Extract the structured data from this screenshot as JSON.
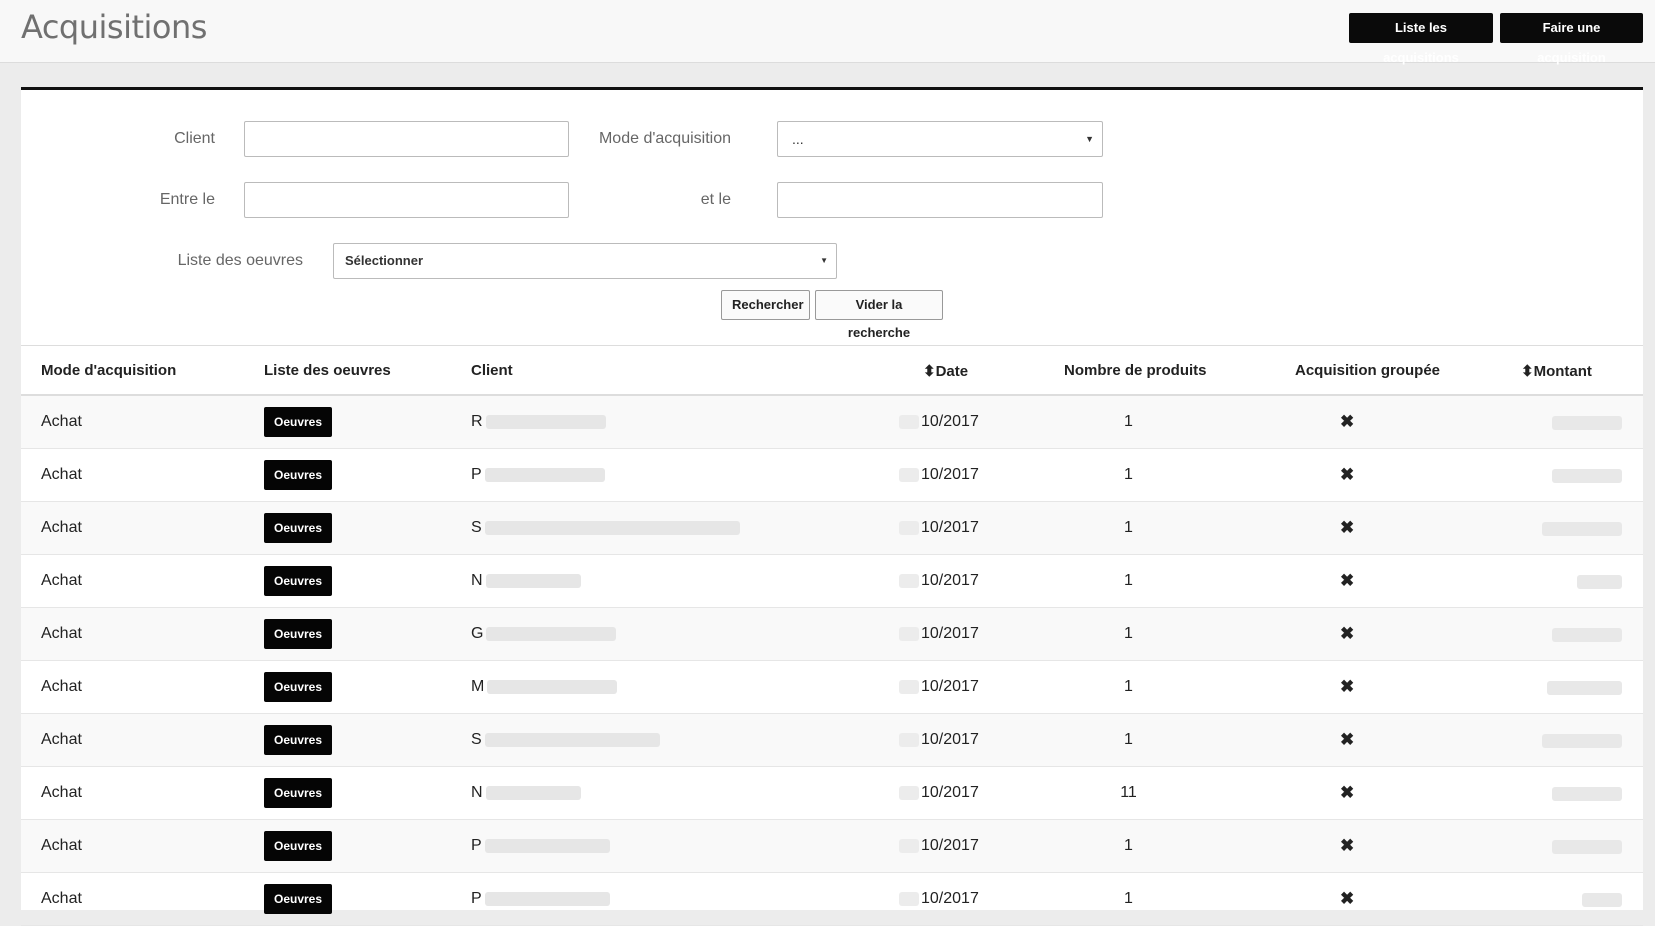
{
  "header": {
    "title": "Acquisitions",
    "list_button": "Liste les acquisitions",
    "new_button": "Faire une acquisition"
  },
  "filters": {
    "client_label": "Client",
    "client_value": "",
    "mode_label": "Mode d'acquisition",
    "mode_value": "...",
    "from_label": "Entre le",
    "from_value": "",
    "to_label": "et le",
    "to_value": "",
    "works_label": "Liste des oeuvres",
    "works_value": "Sélectionner",
    "search_button": "Rechercher",
    "clear_button": "Vider la recherche"
  },
  "table": {
    "columns": {
      "mode": "Mode d'acquisition",
      "works": "Liste des oeuvres",
      "client": "Client",
      "date": "Date",
      "count": "Nombre de produits",
      "grouped": "Acquisition groupée",
      "amount": "Montant"
    },
    "sort_icon": "sort-icon",
    "rows": [
      {
        "mode": "Achat",
        "works": "Oeuvres",
        "client_initial": "R",
        "date": "10/2017",
        "count": "1",
        "grouped": "✖"
      },
      {
        "mode": "Achat",
        "works": "Oeuvres",
        "client_initial": "P",
        "date": "10/2017",
        "count": "1",
        "grouped": "✖"
      },
      {
        "mode": "Achat",
        "works": "Oeuvres",
        "client_initial": "S",
        "date": "10/2017",
        "count": "1",
        "grouped": "✖"
      },
      {
        "mode": "Achat",
        "works": "Oeuvres",
        "client_initial": "N",
        "date": "10/2017",
        "count": "1",
        "grouped": "✖"
      },
      {
        "mode": "Achat",
        "works": "Oeuvres",
        "client_initial": "G",
        "date": "10/2017",
        "count": "1",
        "grouped": "✖"
      },
      {
        "mode": "Achat",
        "works": "Oeuvres",
        "client_initial": "M",
        "date": "10/2017",
        "count": "1",
        "grouped": "✖"
      },
      {
        "mode": "Achat",
        "works": "Oeuvres",
        "client_initial": "S",
        "date": "10/2017",
        "count": "1",
        "grouped": "✖"
      },
      {
        "mode": "Achat",
        "works": "Oeuvres",
        "client_initial": "N",
        "date": "10/2017",
        "count": "11",
        "grouped": "✖"
      },
      {
        "mode": "Achat",
        "works": "Oeuvres",
        "client_initial": "P",
        "date": "10/2017",
        "count": "1",
        "grouped": "✖"
      },
      {
        "mode": "Achat",
        "works": "Oeuvres",
        "client_initial": "P",
        "date": "10/2017",
        "count": "1",
        "grouped": "✖"
      }
    ]
  }
}
